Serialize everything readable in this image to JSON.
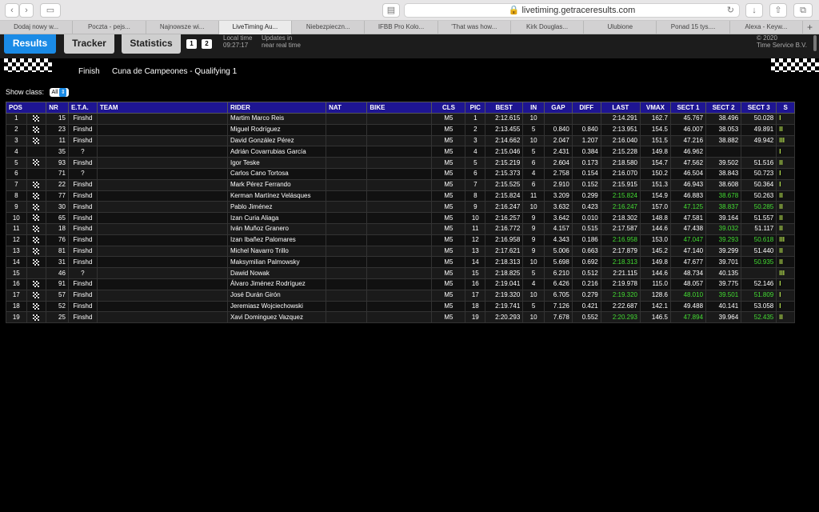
{
  "browser": {
    "url": "livetiming.getraceresults.com",
    "tabs": [
      "Dodaj nowy w...",
      "Poczta - pejs...",
      "Najnowsze wi...",
      "LiveTiming Au...",
      "Niebezpieczn...",
      "IFBB Pro Kolo...",
      "'That was how...",
      "Kirk Douglas...",
      "Ulubione",
      "Ponad 15 tys....",
      "Alexa - Keyw..."
    ],
    "active_tab": 3,
    "plus": "+"
  },
  "nav": {
    "results": "Results",
    "tracker": "Tracker",
    "statistics": "Statistics",
    "page1": "1",
    "page2": "2",
    "local_time_label": "Local time",
    "local_time": "09:27:17",
    "updates_label": "Updates in",
    "updates_value": "near real time",
    "copyright": "© 2020",
    "company": "Time Service B.V."
  },
  "session": {
    "status": "Finish",
    "name": "Cuna de Campeones - Qualifying 1"
  },
  "filter": {
    "label": "Show class:",
    "value": "All"
  },
  "table": {
    "headers": [
      "POS",
      "NR",
      "E.T.A.",
      "TEAM",
      "RIDER",
      "NAT",
      "BIKE",
      "CLS",
      "PIC",
      "BEST",
      "IN",
      "GAP",
      "DIFF",
      "LAST",
      "VMAX",
      "SECT 1",
      "SECT 2",
      "SECT 3",
      "S"
    ],
    "rows": [
      {
        "pos": "1",
        "flag": true,
        "nr": "15",
        "eta": "Finshd",
        "team": "",
        "rider": "Martim Marco Reis",
        "nat": "",
        "bike": "",
        "cls": "M5",
        "pic": "1",
        "best": "2:12.615",
        "in": "10",
        "gap": "",
        "diff": "",
        "last": "2:14.291",
        "last_g": false,
        "vmax": "162.7",
        "s1": "45.767",
        "s1_g": false,
        "s2": "38.496",
        "s2_g": false,
        "s3": "50.028",
        "s3_g": false,
        "s": "I"
      },
      {
        "pos": "2",
        "flag": true,
        "nr": "23",
        "eta": "Finshd",
        "team": "",
        "rider": "Miguel Rodríguez",
        "nat": "",
        "bike": "",
        "cls": "M5",
        "pic": "2",
        "best": "2:13.455",
        "in": "5",
        "gap": "0.840",
        "diff": "0.840",
        "last": "2:13.951",
        "last_g": false,
        "vmax": "154.5",
        "s1": "46.007",
        "s1_g": false,
        "s2": "38.053",
        "s2_g": false,
        "s3": "49.891",
        "s3_g": false,
        "s": "II"
      },
      {
        "pos": "3",
        "flag": true,
        "nr": "11",
        "eta": "Finshd",
        "team": "",
        "rider": "David González Pérez",
        "nat": "",
        "bike": "",
        "cls": "M5",
        "pic": "3",
        "best": "2:14.662",
        "in": "10",
        "gap": "2.047",
        "diff": "1.207",
        "last": "2:16.040",
        "last_g": false,
        "vmax": "151.5",
        "s1": "47.216",
        "s1_g": false,
        "s2": "38.882",
        "s2_g": false,
        "s3": "49.942",
        "s3_g": false,
        "s": "III"
      },
      {
        "pos": "4",
        "flag": false,
        "nr": "35",
        "eta": "?",
        "team": "",
        "rider": "Adrián Covarrubias García",
        "nat": "",
        "bike": "",
        "cls": "M5",
        "pic": "4",
        "best": "2:15.046",
        "in": "5",
        "gap": "2.431",
        "diff": "0.384",
        "last": "2:15.228",
        "last_g": false,
        "vmax": "149.8",
        "s1": "46.962",
        "s1_g": false,
        "s2": "",
        "s2_g": false,
        "s3": "",
        "s3_g": false,
        "s": "I"
      },
      {
        "pos": "5",
        "flag": true,
        "nr": "93",
        "eta": "Finshd",
        "team": "",
        "rider": "Igor Teske",
        "nat": "",
        "bike": "",
        "cls": "M5",
        "pic": "5",
        "best": "2:15.219",
        "in": "6",
        "gap": "2.604",
        "diff": "0.173",
        "last": "2:18.580",
        "last_g": false,
        "vmax": "154.7",
        "s1": "47.562",
        "s1_g": false,
        "s2": "39.502",
        "s2_g": false,
        "s3": "51.516",
        "s3_g": false,
        "s": "II"
      },
      {
        "pos": "6",
        "flag": false,
        "nr": "71",
        "eta": "?",
        "team": "",
        "rider": "Carlos Cano Tortosa",
        "nat": "",
        "bike": "",
        "cls": "M5",
        "pic": "6",
        "best": "2:15.373",
        "in": "4",
        "gap": "2.758",
        "diff": "0.154",
        "last": "2:16.070",
        "last_g": false,
        "vmax": "150.2",
        "s1": "46.504",
        "s1_g": false,
        "s2": "38.843",
        "s2_g": false,
        "s3": "50.723",
        "s3_g": false,
        "s": "I"
      },
      {
        "pos": "7",
        "flag": true,
        "nr": "22",
        "eta": "Finshd",
        "team": "",
        "rider": "Mark Pérez Ferrando",
        "nat": "",
        "bike": "",
        "cls": "M5",
        "pic": "7",
        "best": "2:15.525",
        "in": "6",
        "gap": "2.910",
        "diff": "0.152",
        "last": "2:15.915",
        "last_g": false,
        "vmax": "151.3",
        "s1": "46.943",
        "s1_g": false,
        "s2": "38.608",
        "s2_g": false,
        "s3": "50.364",
        "s3_g": false,
        "s": "I"
      },
      {
        "pos": "8",
        "flag": true,
        "nr": "77",
        "eta": "Finshd",
        "team": "",
        "rider": "Kerman Martínez Velásques",
        "nat": "",
        "bike": "",
        "cls": "M5",
        "pic": "8",
        "best": "2:15.824",
        "in": "11",
        "gap": "3.209",
        "diff": "0.299",
        "last": "2:15.824",
        "last_g": true,
        "vmax": "154.9",
        "s1": "46.883",
        "s1_g": false,
        "s2": "38.678",
        "s2_g": true,
        "s3": "50.263",
        "s3_g": false,
        "s": "II"
      },
      {
        "pos": "9",
        "flag": true,
        "nr": "30",
        "eta": "Finshd",
        "team": "",
        "rider": "Pablo Jiménez",
        "nat": "",
        "bike": "",
        "cls": "M5",
        "pic": "9",
        "best": "2:16.247",
        "in": "10",
        "gap": "3.632",
        "diff": "0.423",
        "last": "2:16.247",
        "last_g": true,
        "vmax": "157.0",
        "s1": "47.125",
        "s1_g": true,
        "s2": "38.837",
        "s2_g": true,
        "s3": "50.285",
        "s3_g": true,
        "s": "II"
      },
      {
        "pos": "10",
        "flag": true,
        "nr": "65",
        "eta": "Finshd",
        "team": "",
        "rider": "Izan Curia Aliaga",
        "nat": "",
        "bike": "",
        "cls": "M5",
        "pic": "10",
        "best": "2:16.257",
        "in": "9",
        "gap": "3.642",
        "diff": "0.010",
        "last": "2:18.302",
        "last_g": false,
        "vmax": "148.8",
        "s1": "47.581",
        "s1_g": false,
        "s2": "39.164",
        "s2_g": false,
        "s3": "51.557",
        "s3_g": false,
        "s": "II"
      },
      {
        "pos": "11",
        "flag": true,
        "nr": "18",
        "eta": "Finshd",
        "team": "",
        "rider": "Iván Muñoz Granero",
        "nat": "",
        "bike": "",
        "cls": "M5",
        "pic": "11",
        "best": "2:16.772",
        "in": "9",
        "gap": "4.157",
        "diff": "0.515",
        "last": "2:17.587",
        "last_g": false,
        "vmax": "144.6",
        "s1": "47.438",
        "s1_g": false,
        "s2": "39.032",
        "s2_g": true,
        "s3": "51.117",
        "s3_g": false,
        "s": "II"
      },
      {
        "pos": "12",
        "flag": true,
        "nr": "76",
        "eta": "Finshd",
        "team": "",
        "rider": "Izan Ibañez Palomares",
        "nat": "",
        "bike": "",
        "cls": "M5",
        "pic": "12",
        "best": "2:16.958",
        "in": "9",
        "gap": "4.343",
        "diff": "0.186",
        "last": "2:16.958",
        "last_g": true,
        "vmax": "153.0",
        "s1": "47.047",
        "s1_g": true,
        "s2": "39.293",
        "s2_g": true,
        "s3": "50.618",
        "s3_g": true,
        "s": "III"
      },
      {
        "pos": "13",
        "flag": true,
        "nr": "81",
        "eta": "Finshd",
        "team": "",
        "rider": "Michel Navarro Trillo",
        "nat": "",
        "bike": "",
        "cls": "M5",
        "pic": "13",
        "best": "2:17.621",
        "in": "9",
        "gap": "5.006",
        "diff": "0.663",
        "last": "2:17.879",
        "last_g": false,
        "vmax": "145.2",
        "s1": "47.140",
        "s1_g": false,
        "s2": "39.299",
        "s2_g": false,
        "s3": "51.440",
        "s3_g": false,
        "s": "II"
      },
      {
        "pos": "14",
        "flag": true,
        "nr": "31",
        "eta": "Finshd",
        "team": "",
        "rider": "Maksymilian Palmowsky",
        "nat": "",
        "bike": "",
        "cls": "M5",
        "pic": "14",
        "best": "2:18.313",
        "in": "10",
        "gap": "5.698",
        "diff": "0.692",
        "last": "2:18.313",
        "last_g": true,
        "vmax": "149.8",
        "s1": "47.677",
        "s1_g": false,
        "s2": "39.701",
        "s2_g": false,
        "s3": "50.935",
        "s3_g": true,
        "s": "II"
      },
      {
        "pos": "15",
        "flag": false,
        "nr": "46",
        "eta": "?",
        "team": "",
        "rider": "Dawid Nowak",
        "nat": "",
        "bike": "",
        "cls": "M5",
        "pic": "15",
        "best": "2:18.825",
        "in": "5",
        "gap": "6.210",
        "diff": "0.512",
        "last": "2:21.115",
        "last_g": false,
        "vmax": "144.6",
        "s1": "48.734",
        "s1_g": false,
        "s2": "40.135",
        "s2_g": false,
        "s3": "",
        "s3_g": false,
        "s": "III"
      },
      {
        "pos": "16",
        "flag": true,
        "nr": "91",
        "eta": "Finshd",
        "team": "",
        "rider": "Álvaro Jiménez Rodríguez",
        "nat": "",
        "bike": "",
        "cls": "M5",
        "pic": "16",
        "best": "2:19.041",
        "in": "4",
        "gap": "6.426",
        "diff": "0.216",
        "last": "2:19.978",
        "last_g": false,
        "vmax": "115.0",
        "s1": "48.057",
        "s1_g": false,
        "s2": "39.775",
        "s2_g": false,
        "s3": "52.146",
        "s3_g": false,
        "s": "I"
      },
      {
        "pos": "17",
        "flag": true,
        "nr": "57",
        "eta": "Finshd",
        "team": "",
        "rider": "José Durán Girón",
        "nat": "",
        "bike": "",
        "cls": "M5",
        "pic": "17",
        "best": "2:19.320",
        "in": "10",
        "gap": "6.705",
        "diff": "0.279",
        "last": "2:19.320",
        "last_g": true,
        "vmax": "128.6",
        "s1": "48.010",
        "s1_g": true,
        "s2": "39.501",
        "s2_g": true,
        "s3": "51.809",
        "s3_g": true,
        "s": "I"
      },
      {
        "pos": "18",
        "flag": true,
        "nr": "52",
        "eta": "Finshd",
        "team": "",
        "rider": "Jeremiasz Wojciechowski",
        "nat": "",
        "bike": "",
        "cls": "M5",
        "pic": "18",
        "best": "2:19.741",
        "in": "5",
        "gap": "7.126",
        "diff": "0.421",
        "last": "2:22.687",
        "last_g": false,
        "vmax": "142.1",
        "s1": "49.488",
        "s1_g": false,
        "s2": "40.141",
        "s2_g": false,
        "s3": "53.058",
        "s3_g": false,
        "s": "I"
      },
      {
        "pos": "19",
        "flag": true,
        "nr": "25",
        "eta": "Finshd",
        "team": "",
        "rider": "Xavi Dominguez Vazquez",
        "nat": "",
        "bike": "",
        "cls": "M5",
        "pic": "19",
        "best": "2:20.293",
        "in": "10",
        "gap": "7.678",
        "diff": "0.552",
        "last": "2:20.293",
        "last_g": true,
        "vmax": "146.5",
        "s1": "47.894",
        "s1_g": true,
        "s2": "39.964",
        "s2_g": false,
        "s3": "52.435",
        "s3_g": true,
        "s": "II"
      }
    ]
  },
  "colors": {
    "header_bg": "#1e1592",
    "accent": "#1a8be6",
    "best_green": "#44dd33",
    "sector_bars": "#b3e04c"
  }
}
